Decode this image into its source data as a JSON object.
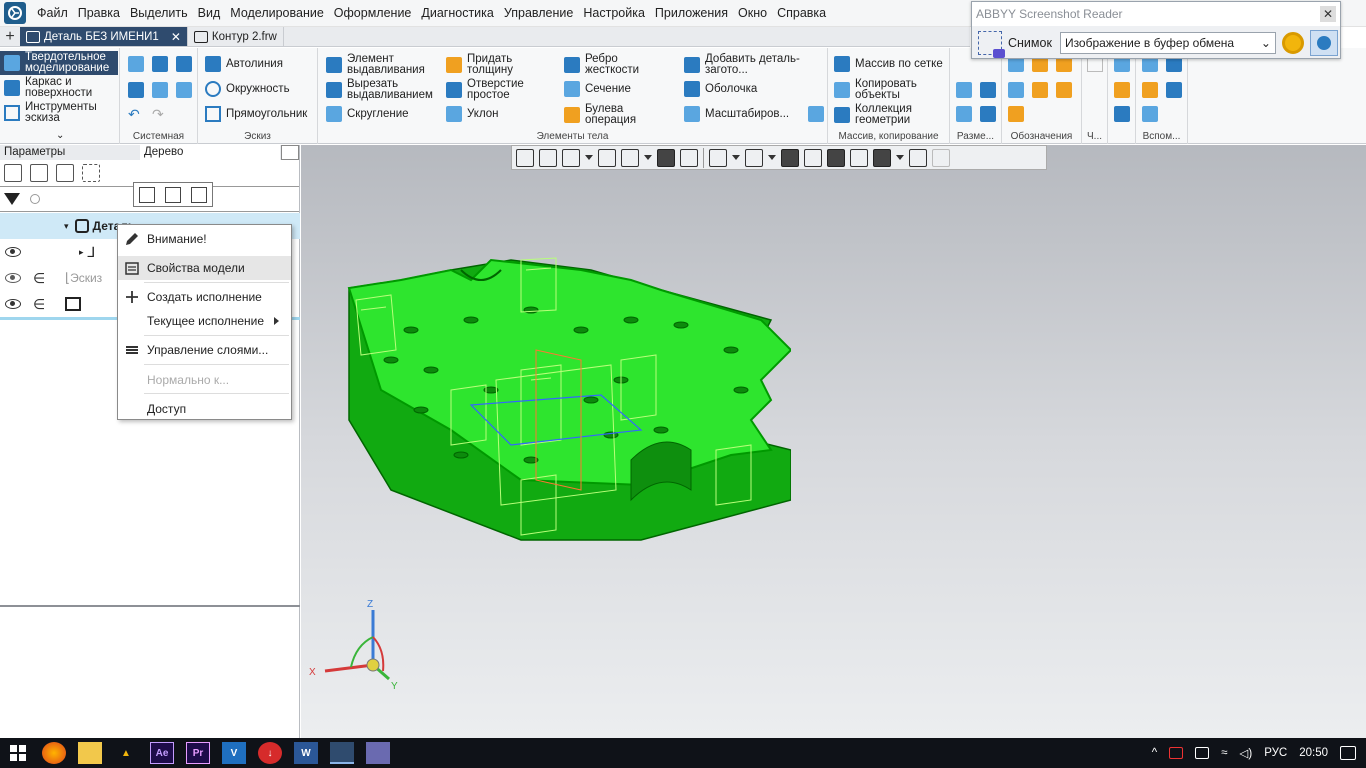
{
  "menu": [
    "Файл",
    "Правка",
    "Выделить",
    "Вид",
    "Моделирование",
    "Оформление",
    "Диагностика",
    "Управление",
    "Настройка",
    "Приложения",
    "Окно",
    "Справка"
  ],
  "tabs": [
    {
      "label": "Деталь БЕЗ ИМЕНИ1",
      "active": true
    },
    {
      "label": "Контур 2.frw",
      "active": false
    }
  ],
  "ribbon": {
    "modes": [
      {
        "label": "Твердотельное моделирование",
        "active": true
      },
      {
        "label": "Каркас и поверхности",
        "active": false
      },
      {
        "label": "Инструменты эскиза",
        "active": false
      }
    ],
    "groups": {
      "system": "Системная",
      "sketch": "Эскиз",
      "body": "Элементы тела",
      "array": "Массив, копирование",
      "dims": "Разме...",
      "notes": "Обозначения",
      "ch": "Ч...",
      "aux": "Вспом..."
    },
    "sketch_buttons": [
      "Автолиния",
      "Окружность",
      "Прямоугольник"
    ],
    "body_buttons": [
      "Элемент выдавливания",
      "Вырезать выдавливанием",
      "Скругление",
      "Придать толщину",
      "Отверстие простое",
      "Уклон",
      "Ребро жесткости",
      "Сечение",
      "Булева операция",
      "Добавить деталь-загото...",
      "Оболочка",
      "Масштабиров..."
    ],
    "array_buttons": [
      "Массив по сетке",
      "Копировать объекты",
      "Коллекция геометрии"
    ]
  },
  "abbyy": {
    "title": "ABBYY Screenshot Reader",
    "snap_label": "Снимок",
    "target": "Изображение в буфер обмена"
  },
  "panel": {
    "tabs": [
      "Параметры",
      "Дерево"
    ],
    "tree_rows": [
      "Деталь",
      "Эскиз"
    ]
  },
  "context_menu": [
    {
      "label": "Внимание!",
      "icon": "pencil-icon",
      "disabled": false
    },
    {
      "label": "Свойства модели",
      "icon": "properties-icon",
      "disabled": false
    },
    {
      "label": "Создать исполнение",
      "icon": "plus-icon",
      "disabled": false
    },
    {
      "label": "Текущее исполнение",
      "icon": "",
      "disabled": false,
      "submenu": true
    },
    {
      "label": "Управление слоями...",
      "icon": "layers-icon",
      "disabled": false
    },
    {
      "label": "Нормально к...",
      "icon": "",
      "disabled": true
    },
    {
      "label": "Доступ",
      "icon": "",
      "disabled": false
    }
  ],
  "axes": {
    "x": "X",
    "y": "Y",
    "z": "Z"
  },
  "taskbar": {
    "apps": [
      "firefox-icon",
      "explorer-icon",
      "app-icon",
      "Ae",
      "Pr",
      "V",
      "download-icon",
      "W",
      "kompas-icon",
      "app2-icon"
    ],
    "lang": "РУС",
    "time": "20:50"
  },
  "colors": {
    "accent": "#2f4b6e",
    "model": "#22dd22",
    "model_edge": "#00a000"
  }
}
